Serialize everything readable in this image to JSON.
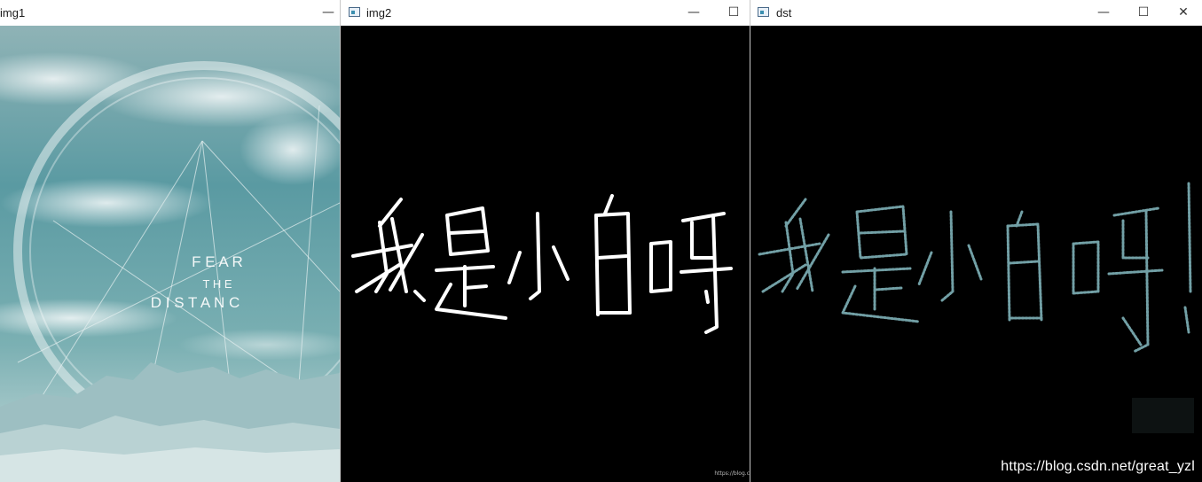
{
  "windows": {
    "img1": {
      "title": "img1",
      "controls": {
        "minimize": "—"
      }
    },
    "img2": {
      "title": "img2",
      "controls": {
        "minimize": "—",
        "maximize": "☐"
      },
      "corner_mark": "https://blog.c"
    },
    "dst": {
      "title": "dst",
      "controls": {
        "minimize": "—",
        "maximize": "☐",
        "close": "✕"
      },
      "corner_mark": "https://blog.csdn"
    }
  },
  "poster": {
    "line1": "F E A R",
    "line2": "T H E",
    "line3": "D I S T A N C"
  },
  "handwriting": {
    "text": "我是小白呀"
  },
  "watermark": "https://blog.csdn.net/great_yzl",
  "colors": {
    "titlebar": "#ffffff",
    "image_bg": "#000000",
    "sky": "#5f9aa3",
    "stroke": "#ffffff",
    "edge": "#7fb2b8"
  },
  "icons": [
    "app-window-icon",
    "minimize-icon",
    "maximize-icon",
    "close-icon"
  ]
}
